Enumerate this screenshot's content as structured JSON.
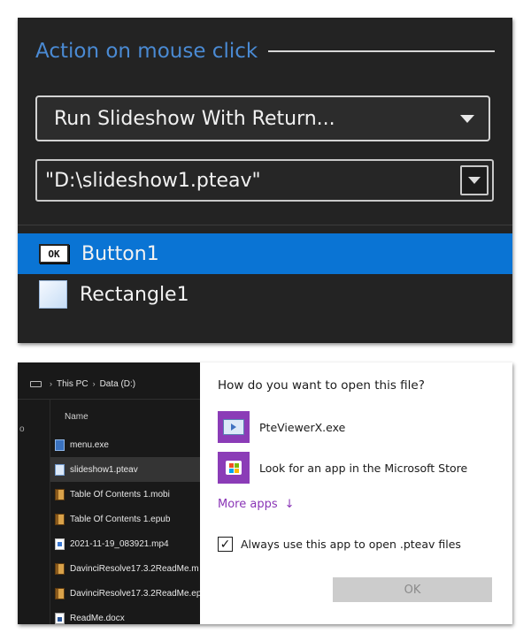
{
  "top_panel": {
    "section_title": "Action on mouse click",
    "action_select": {
      "value": "Run Slideshow With Return..."
    },
    "file_combo": {
      "value": "\"D:\\slideshow1.pteav\""
    },
    "objects": [
      {
        "label": "Button1",
        "icon": "ok-button-icon",
        "selected": true
      },
      {
        "label": "Rectangle1",
        "icon": "rectangle-icon",
        "selected": false
      }
    ],
    "ok_icon_text": "OK"
  },
  "explorer": {
    "breadcrumb": [
      "This PC",
      "Data (D:)"
    ],
    "column_name": "Name",
    "side_char": "o",
    "files": [
      {
        "name": "menu.exe",
        "icon": "exe"
      },
      {
        "name": "slideshow1.pteav",
        "icon": "pteav",
        "selected": true
      },
      {
        "name": "Table Of Contents 1.mobi",
        "icon": "book"
      },
      {
        "name": "Table Of Contents 1.epub",
        "icon": "book"
      },
      {
        "name": "2021-11-19_083921.mp4",
        "icon": "mp4"
      },
      {
        "name": "DavinciResolve17.3.2ReadMe.m",
        "icon": "book"
      },
      {
        "name": "DavinciResolve17.3.2ReadMe.ep",
        "icon": "book"
      },
      {
        "name": "ReadMe.docx",
        "icon": "docx"
      }
    ]
  },
  "dialog": {
    "title": "How do you want to open this file?",
    "apps": [
      {
        "name": "PteViewerX.exe",
        "icon": "pteviewer-icon"
      },
      {
        "name": "Look for an app in the Microsoft Store",
        "icon": "microsoft-store-icon"
      }
    ],
    "more_apps": "More apps",
    "more_apps_arrow": "↓",
    "always_use": "Always use this app to open .pteav files",
    "always_checked": true,
    "ok_label": "OK"
  },
  "colors": {
    "accent_blue": "#0a74d4",
    "title_blue": "#4a8ad3",
    "link_purple": "#8a35b6",
    "app_tile_purple": "#8b3cb7"
  }
}
